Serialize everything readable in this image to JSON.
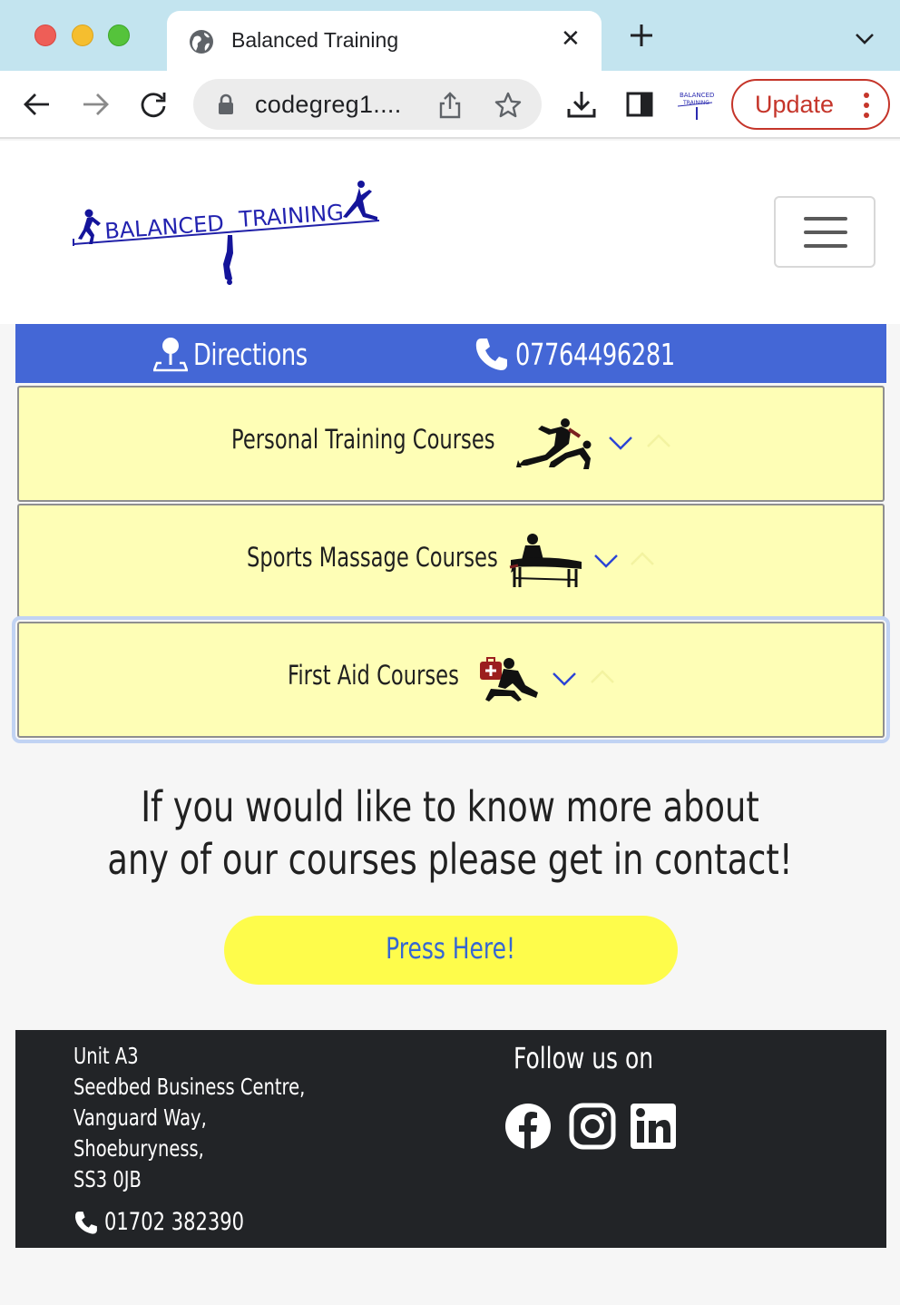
{
  "browser": {
    "tab_title": "Balanced Training",
    "url": "codegreg1....",
    "update_label": "Update",
    "extension_logo_text": [
      "BALANCED",
      "TRAINING"
    ]
  },
  "site": {
    "logo_text_left": "BALANCED",
    "logo_text_right": "TRAINING",
    "contact_bar": {
      "directions_label": "Directions",
      "phone_label": "07764496281",
      "background": "#4467d6"
    },
    "courses": [
      {
        "label": "Personal Training Courses",
        "image_icon": "personal-training-silhouette-icon"
      },
      {
        "label": "Sports Massage Courses",
        "image_icon": "sports-massage-silhouette-icon"
      },
      {
        "label": "First Aid Courses",
        "image_icon": "first-aid-silhouette-icon"
      }
    ],
    "course_background": "#fefeb6",
    "cta": {
      "line1": "If you would like to know more about",
      "line2": "any of our courses please get in contact!",
      "button_label": "Press Here!",
      "button_color": "#fefc4b"
    },
    "footer": {
      "address": [
        "Unit A3",
        "Seedbed Business Centre,",
        "Vanguard Way,",
        "Shoeburyness,",
        "SS3 0JB"
      ],
      "phone": "01702 382390",
      "follow_label": "Follow us on",
      "socials": [
        "facebook-icon",
        "instagram-icon",
        "linkedin-icon"
      ],
      "background": "#222427"
    }
  }
}
